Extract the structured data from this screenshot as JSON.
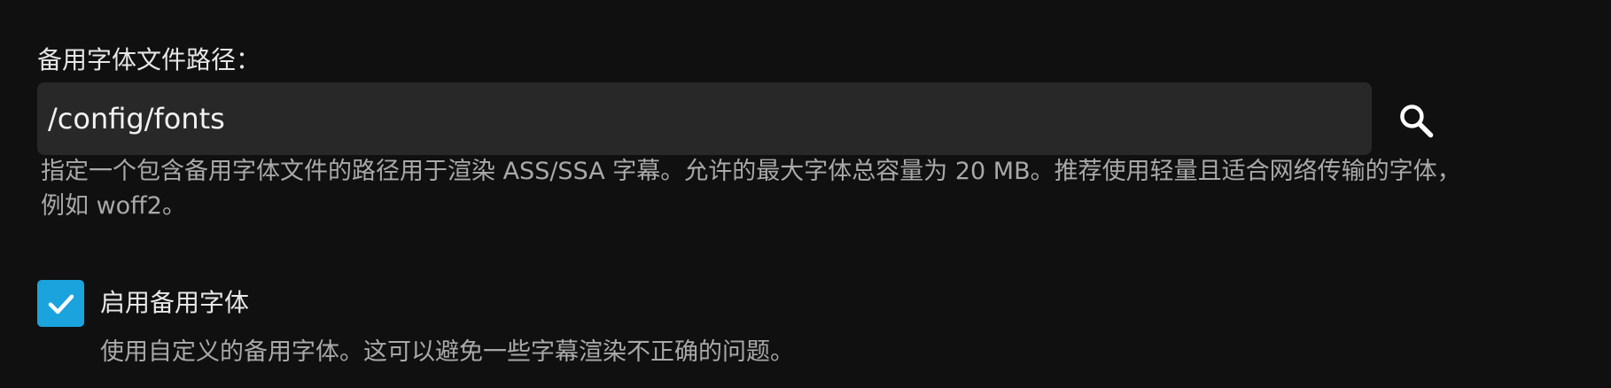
{
  "fallback_font": {
    "label": "备用字体文件路径：",
    "path_value": "/config/fonts",
    "search_icon": "magnifier-icon",
    "help_text": "指定一个包含备用字体文件的路径用于渲染 ASS/SSA 字幕。允许的最大字体总容量为 20 MB。推荐使用轻量且适合网络传输的字体，例如 woff2。"
  },
  "enable_fallback": {
    "checked": true,
    "check_icon": "checkmark-icon",
    "label": "启用备用字体",
    "description": "使用自定义的备用字体。这可以避免一些字幕渲染不正确的问题。"
  },
  "colors": {
    "background": "#101010",
    "input_background": "#282828",
    "accent": "#1ba3de",
    "secondary_text": "#a9a9a9"
  }
}
